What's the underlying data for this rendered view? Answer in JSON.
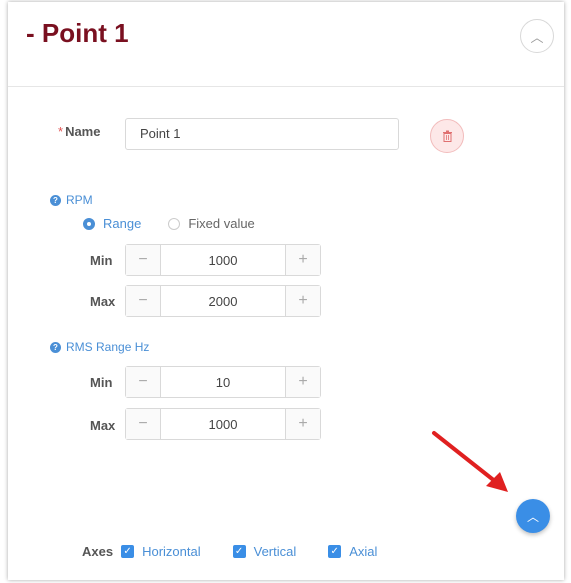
{
  "card": {
    "title": "- Point 1"
  },
  "name_field": {
    "required_mark": "*",
    "label": "Name",
    "value": "Point 1"
  },
  "rpm": {
    "label": "RPM",
    "mode_options": [
      "Range",
      "Fixed value"
    ],
    "selected_mode": "Range",
    "min_label": "Min",
    "min_value": "1000",
    "max_label": "Max",
    "max_value": "2000"
  },
  "rms": {
    "label": "RMS Range Hz",
    "min_label": "Min",
    "min_value": "10",
    "max_label": "Max",
    "max_value": "1000"
  },
  "axes": {
    "label": "Axes",
    "options": [
      {
        "label": "Horizontal",
        "checked": true
      },
      {
        "label": "Vertical",
        "checked": true
      },
      {
        "label": "Axial",
        "checked": true
      }
    ]
  },
  "icons": {
    "collapse": "chevron-up-icon",
    "delete": "trash-icon",
    "help": "question-circle-icon",
    "scroll_top": "chevron-up-icon",
    "annotation": "red-arrow-icon"
  },
  "colors": {
    "title": "#7a1020",
    "accent": "#3a8ee6",
    "delete_bg": "#fde8e8",
    "arrow": "#e02020"
  },
  "stepper": {
    "minus": "−",
    "plus": "+"
  }
}
